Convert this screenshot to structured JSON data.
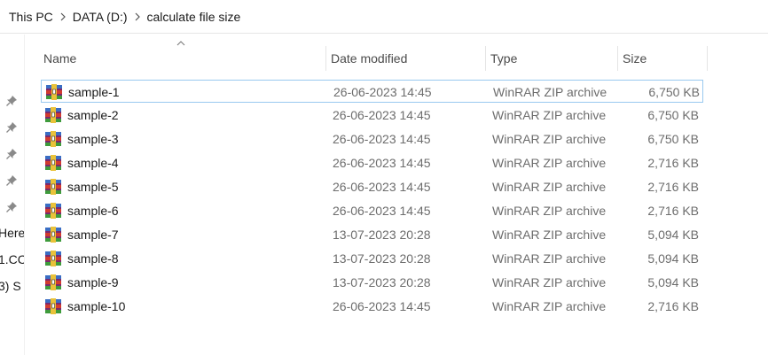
{
  "breadcrumb": [
    "This PC",
    "DATA (D:)",
    "calculate file size"
  ],
  "nav_fragments": [
    "Here",
    "1.CC",
    "3) S"
  ],
  "columns": {
    "name": "Name",
    "date": "Date modified",
    "type": "Type",
    "size": "Size"
  },
  "icons": {
    "file": "winrar-archive-icon",
    "pin": "pin-icon",
    "separator": "chevron-right-icon",
    "sort": "sort-ascending-icon"
  },
  "colors": {
    "selection_border": "#99c9ef",
    "secondary_text": "#6d6d6d"
  },
  "files": [
    {
      "name": "sample-1",
      "date": "26-06-2023 14:45",
      "type": "WinRAR ZIP archive",
      "size": "6,750 KB",
      "selected": true
    },
    {
      "name": "sample-2",
      "date": "26-06-2023 14:45",
      "type": "WinRAR ZIP archive",
      "size": "6,750 KB"
    },
    {
      "name": "sample-3",
      "date": "26-06-2023 14:45",
      "type": "WinRAR ZIP archive",
      "size": "6,750 KB"
    },
    {
      "name": "sample-4",
      "date": "26-06-2023 14:45",
      "type": "WinRAR ZIP archive",
      "size": "2,716 KB"
    },
    {
      "name": "sample-5",
      "date": "26-06-2023 14:45",
      "type": "WinRAR ZIP archive",
      "size": "2,716 KB"
    },
    {
      "name": "sample-6",
      "date": "26-06-2023 14:45",
      "type": "WinRAR ZIP archive",
      "size": "2,716 KB"
    },
    {
      "name": "sample-7",
      "date": "13-07-2023 20:28",
      "type": "WinRAR ZIP archive",
      "size": "5,094 KB"
    },
    {
      "name": "sample-8",
      "date": "13-07-2023 20:28",
      "type": "WinRAR ZIP archive",
      "size": "5,094 KB"
    },
    {
      "name": "sample-9",
      "date": "13-07-2023 20:28",
      "type": "WinRAR ZIP archive",
      "size": "5,094 KB"
    },
    {
      "name": "sample-10",
      "date": "26-06-2023 14:45",
      "type": "WinRAR ZIP archive",
      "size": "2,716 KB"
    }
  ]
}
